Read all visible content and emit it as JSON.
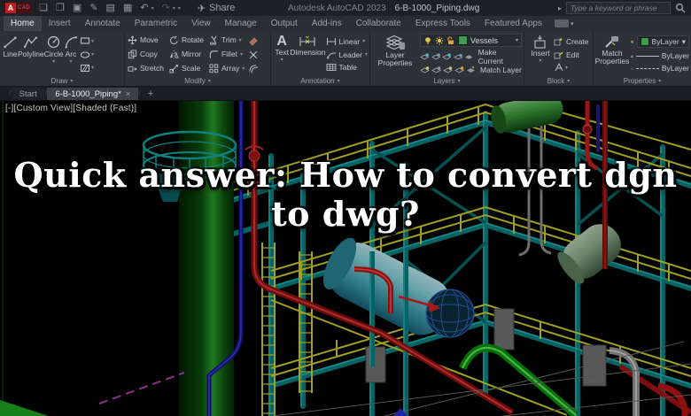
{
  "window": {
    "logo_a": "A",
    "logo_cad": "CAD",
    "app_title": "Autodesk AutoCAD 2023",
    "document_title": "6-B-1000_Piping.dwg",
    "share_label": "Share",
    "search_placeholder": "Type a keyword or phrase"
  },
  "icons": {
    "caret": "▾",
    "expand": "▸",
    "text_glyph": "A",
    "qat": {
      "new": "❏",
      "open": "❐",
      "save": "▣",
      "save_as": "✎",
      "plot": "▤",
      "print": "▦",
      "undo": "↶",
      "redo": "↷",
      "customize": "▾",
      "share": "✈"
    }
  },
  "ribbon_tabs": [
    "Home",
    "Insert",
    "Annotate",
    "Parametric",
    "View",
    "Manage",
    "Output",
    "Add-ins",
    "Collaborate",
    "Express Tools",
    "Featured Apps"
  ],
  "panels": {
    "draw": {
      "label": "Draw",
      "tools": [
        "Line",
        "Polyline",
        "Circle",
        "Arc"
      ]
    },
    "modify": {
      "label": "Modify",
      "tools": [
        "Move",
        "Rotate",
        "Trim",
        "Copy",
        "Mirror",
        "Fillet",
        "Stretch",
        "Scale",
        "Array"
      ]
    },
    "annotation": {
      "label": "Annotation",
      "tools": [
        "Text",
        "Dimension",
        "Linear",
        "Leader",
        "Table"
      ]
    },
    "layers": {
      "label": "Layers",
      "layer_properties": "Layer Properties",
      "current_layer": "Vessels",
      "make_current": "Make Current",
      "match_layer": "Match Layer"
    },
    "block": {
      "label": "Block",
      "tools": [
        "Insert",
        "Create",
        "Edit"
      ]
    },
    "properties": {
      "label": "Properties",
      "match_properties": "Match Properties",
      "color_value": "ByLayer",
      "lineweight_value": "ByLayer",
      "linetype_value": "ByLayer"
    }
  },
  "file_tabs": {
    "start": "Start",
    "document": "6-B-1000_Piping*",
    "close_glyph": "×",
    "new_glyph": "+"
  },
  "viewport": {
    "controls_label": "[-][Custom View][Shaded (Fast)]"
  },
  "overlay_title": {
    "line1": "Quick answer: How to convert dgn",
    "line2": "to dwg?"
  },
  "colors": {
    "accent_red_logo": "#c21c1c",
    "ribbon_bg": "#2d3238",
    "viewport_bg": "#000000",
    "layer_swatch_green": "#3f9b50",
    "model_column_green": "#2a962a",
    "model_steel_teal": "#0d7a7a",
    "model_rail_yellow": "#c9c926",
    "model_pipe_red": "#b51414",
    "model_pipe_blue": "#15158f",
    "model_pipe_green": "#0fae0f",
    "model_vessel_cyan": "#7fcbd4",
    "model_vessel_sage": "#86a586",
    "model_vessel_green": "#3a943a",
    "model_line_magenta": "#b23ab2"
  }
}
